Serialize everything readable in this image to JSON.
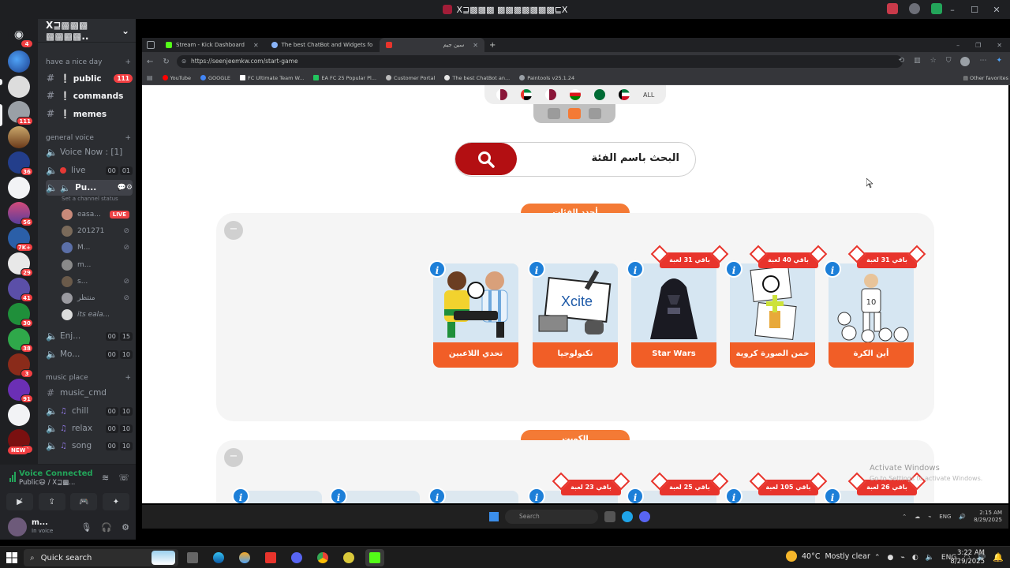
{
  "window": {
    "title": "X⊒▩▩▩ ▩▩▩▩▩▩▩⊑X"
  },
  "server": {
    "name": "X⊒▩▩▩ ▩▩▩▩..",
    "categories": [
      {
        "label": "have a nice day"
      },
      {
        "label": "general voice"
      },
      {
        "label": "music place"
      }
    ],
    "text_channels": [
      {
        "name": "❕ public",
        "badge": "111"
      },
      {
        "name": "❕ commands"
      },
      {
        "name": "❕ memes"
      }
    ],
    "voice_now": "Voice Now : [1]",
    "voice_channels": [
      {
        "name": "live",
        "c1": "00",
        "c2": "01"
      },
      {
        "name": "Pu...",
        "status_hint": "Set a channel status"
      },
      {
        "name": "Enj...",
        "c1": "00",
        "c2": "15"
      },
      {
        "name": "Mo...",
        "c1": "00",
        "c2": "10"
      }
    ],
    "voice_users": [
      {
        "name": "easa...",
        "live": "LIVE"
      },
      {
        "name": "201271"
      },
      {
        "name": "M..."
      },
      {
        "name": "m..."
      },
      {
        "name": "s..."
      },
      {
        "name": "منتظر"
      },
      {
        "name": "its eala..."
      }
    ],
    "music_channels": [
      {
        "name": "music_cmd"
      },
      {
        "name": "chill",
        "c1": "00",
        "c2": "10"
      },
      {
        "name": "relax",
        "c1": "00",
        "c2": "10"
      },
      {
        "name": "song",
        "c1": "00",
        "c2": "10"
      }
    ]
  },
  "rail_badges": [
    "4",
    "111",
    "36",
    "56",
    "7K+",
    "29",
    "41",
    "30",
    "38",
    "3",
    "91",
    "3",
    "NEW"
  ],
  "voice_panel": {
    "status": "Voice Connected",
    "channel": "Public😃 / X⊒▩..."
  },
  "user_panel": {
    "name": "m...",
    "status": "In voice"
  },
  "browser": {
    "tabs": [
      {
        "title": "Stream - Kick Dashboard"
      },
      {
        "title": "The best ChatBot and Widgets fo"
      },
      {
        "title": "سين جيم"
      }
    ],
    "url": "https://seenjeemkw.com/start-game",
    "bookmarks": [
      "YouTube",
      "GOOGLE",
      "FC Ultimate Team W...",
      "EA FC 25 Popular Pl...",
      "Customer Portal",
      "The best ChatBot an...",
      "Paintools v25.1.24"
    ],
    "other_bookmarks": "Other favorites"
  },
  "page": {
    "all_label": "ALL",
    "search_placeholder": "البحث باسم الفئة",
    "section1_title": "أجدد الفئات",
    "section2_title": "الكويت",
    "cards": [
      {
        "label": "أين الكرة",
        "ribbon": "باقي 31 لعبة"
      },
      {
        "label": "خمن الصورة كروية",
        "ribbon": "باقي 40 لعبة"
      },
      {
        "label": "Star Wars",
        "ribbon": "باقي 31 لعبة"
      },
      {
        "label": "تكنولوجيا"
      },
      {
        "label": "تحدي اللاعبين"
      }
    ],
    "xcite_text": "Xcite",
    "jersey_number": "10",
    "row2_ribbons": [
      "باقي 26 لعبة",
      "باقي 105 لعبة",
      "باقي 25 لعبة",
      "باقي 23 لعبة"
    ],
    "watermark_title": "Activate Windows",
    "watermark_sub": "Go to Settings to activate Windows."
  },
  "stream_taskbar": {
    "search": "Search",
    "lang": "ENG",
    "time": "2:15 AM",
    "date": "8/29/2025"
  },
  "taskbar": {
    "search_label": "Quick search",
    "weather_temp": "40°C",
    "weather_desc": "Mostly clear",
    "lang": "ENG",
    "time": "3:22 AM",
    "date": "8/29/2025"
  }
}
